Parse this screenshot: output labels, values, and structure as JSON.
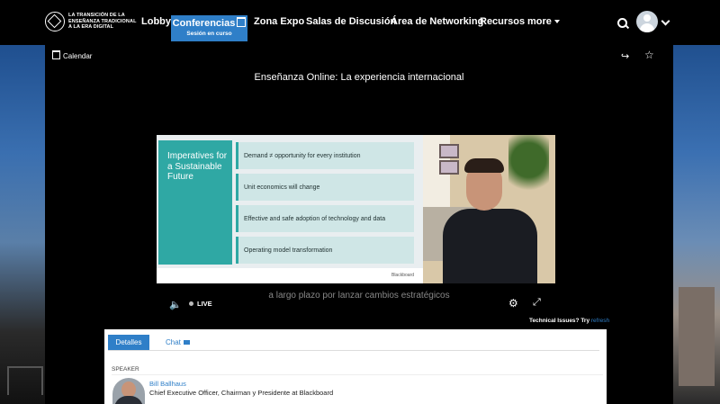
{
  "brand": {
    "logo_line1": "LA TRANSICIÓN DE LA",
    "logo_line2": "ENSEÑANZA TRADICIONAL",
    "logo_line3": "A LA ERA DIGITAL"
  },
  "nav": {
    "lobby": "Lobby",
    "conferencias": "Conferencias",
    "conferencias_sub": "Sesión en curso",
    "expo": "Zona Expo",
    "salas": "Salas de Discusión",
    "networking": "Área de Networking",
    "recursos": "Recursos",
    "more": "more",
    "accent_color": "#2f7fc8"
  },
  "stage": {
    "calendar": "Calendar",
    "title": "Enseñanza Online: La experiencia internacional"
  },
  "slide": {
    "heading": "Imperatives for a Sustainable Future",
    "items": [
      "Demand ≠ opportunity for every institution",
      "Unit economics will change",
      "Effective and safe adoption of technology and data",
      "Operating model transformation"
    ],
    "footer": "Blackboard"
  },
  "player": {
    "live": "LIVE",
    "caption": "a largo plazo por lanzar cambios estratégicos",
    "tech_text": "Technical Issues? Try",
    "tech_link": "refresh"
  },
  "details": {
    "tab_details": "Detalles",
    "tab_chat": "Chat",
    "speaker_label": "SPEAKER",
    "speaker_name": "Bill Ballhaus",
    "speaker_role": "Chief Executive Officer, Chairman y Presidente at Blackboard"
  }
}
